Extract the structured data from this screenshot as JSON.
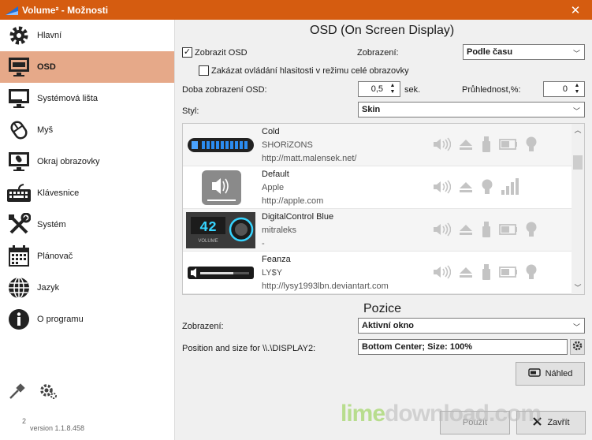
{
  "window": {
    "title": "Volume² - Možnosti",
    "accent": "#d55c10",
    "close_icon": "close-icon"
  },
  "sidebar": {
    "items": [
      {
        "label": "Hlavní",
        "icon": "gear-icon",
        "active": false
      },
      {
        "label": "OSD",
        "icon": "monitor-osd-icon",
        "active": true
      },
      {
        "label": "Systémová lišta",
        "icon": "taskbar-icon",
        "active": false
      },
      {
        "label": "Myš",
        "icon": "mouse-icon",
        "active": false
      },
      {
        "label": "Okraj obrazovky",
        "icon": "screen-edge-icon",
        "active": false
      },
      {
        "label": "Klávesnice",
        "icon": "keyboard-icon",
        "active": false
      },
      {
        "label": "Systém",
        "icon": "tools-icon",
        "active": false
      },
      {
        "label": "Plánovač",
        "icon": "calendar-icon",
        "active": false
      },
      {
        "label": "Jazyk",
        "icon": "globe-icon",
        "active": false
      },
      {
        "label": "O programu",
        "icon": "info-icon",
        "active": false
      }
    ],
    "version_sup": "2",
    "version": "version 1.1.8.458",
    "active_color": "#e6a989"
  },
  "osd": {
    "title": "OSD (On Screen Display)",
    "show_osd_label": "Zobrazit OSD",
    "show_osd_checked": true,
    "disable_fullscreen_label": "Zakázat ovládání hlasitosti v režimu celé obrazovky",
    "disable_fullscreen_checked": false,
    "display_label": "Zobrazení:",
    "display_value": "Podle času",
    "duration_label": "Doba zobrazení OSD:",
    "duration_value": "0,5",
    "duration_unit": "sek.",
    "transparency_label": "Průhlednost,%:",
    "transparency_value": "0",
    "style_label": "Styl:",
    "style_value": "Skin"
  },
  "skins": [
    {
      "name": "Cold",
      "author": "SHORiZONS",
      "url": "http://matt.malensek.net/"
    },
    {
      "name": "Default",
      "author": "Apple",
      "url": "http://apple.com"
    },
    {
      "name": "DigitalControl Blue",
      "author": "mitraleks",
      "url": "-",
      "thumb_digits": "42",
      "thumb_caption": "VOLUME"
    },
    {
      "name": "Feanza",
      "author": "LY$Y",
      "url": "http://lysy1993lbn.deviantart.com"
    }
  ],
  "position": {
    "title": "Pozice",
    "display_label": "Zobrazení:",
    "display_value": "Aktivní okno",
    "pos_label": "Position and size for \\\\.\\DISPLAY2:",
    "pos_value": "Bottom Center; Size: 100%"
  },
  "buttons": {
    "preview": "Náhled",
    "apply": "Použít",
    "close": "Zavřít"
  },
  "watermark": {
    "part1": "lime",
    "part2": "download.com"
  }
}
